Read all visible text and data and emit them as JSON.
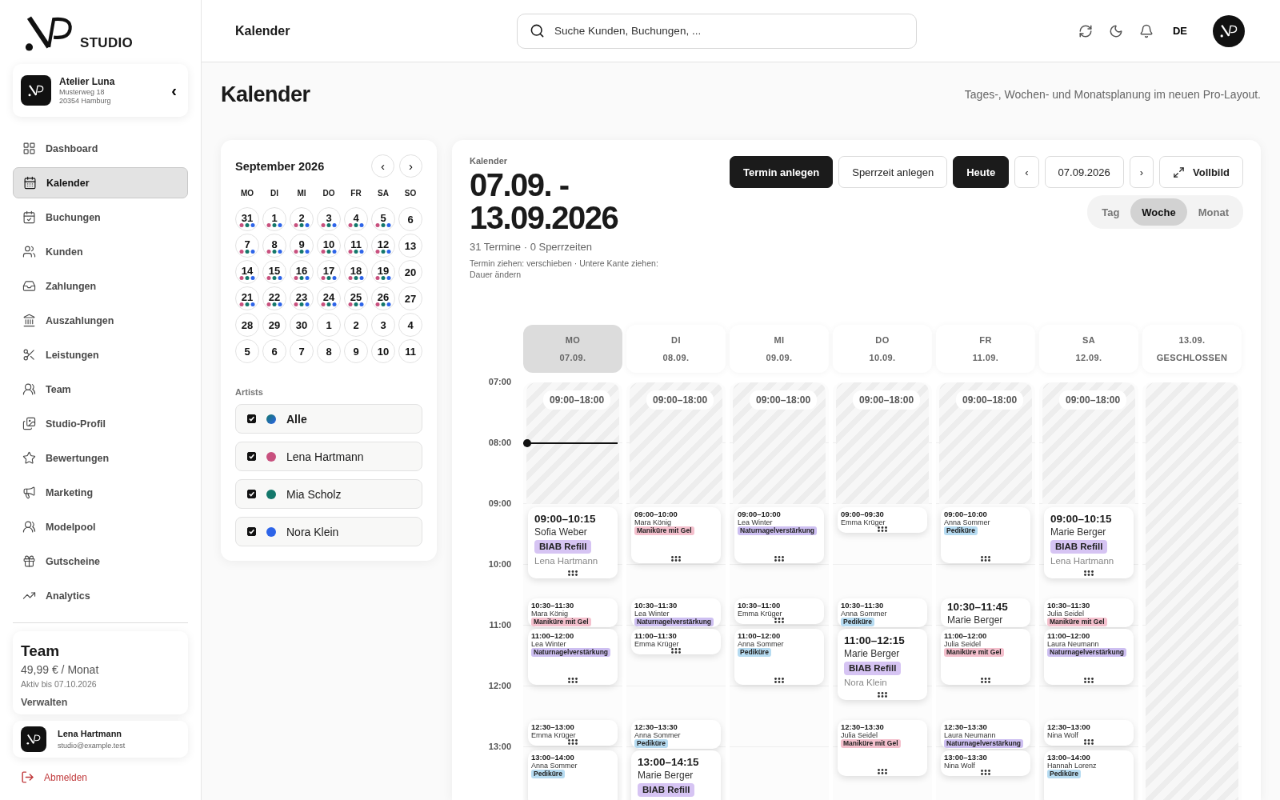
{
  "sidebar": {
    "brand": "STUDIO",
    "studio": {
      "name": "Atelier Luna",
      "street": "Musterweg 18",
      "city": "20354 Hamburg",
      "collapse": "‹"
    },
    "nav": [
      {
        "label": "Dashboard",
        "selected": false
      },
      {
        "label": "Kalender",
        "selected": true
      },
      {
        "label": "Buchungen",
        "selected": false
      },
      {
        "label": "Kunden",
        "selected": false
      },
      {
        "label": "Zahlungen",
        "selected": false
      },
      {
        "label": "Auszahlungen",
        "selected": false
      },
      {
        "label": "Leistungen",
        "selected": false
      },
      {
        "label": "Team",
        "selected": false
      },
      {
        "label": "Studio-Profil",
        "selected": false
      },
      {
        "label": "Bewertungen",
        "selected": false
      },
      {
        "label": "Marketing",
        "selected": false
      },
      {
        "label": "Modelpool",
        "selected": false
      },
      {
        "label": "Gutscheine",
        "selected": false
      },
      {
        "label": "Analytics",
        "selected": false
      }
    ],
    "plan": {
      "name": "Team",
      "price": "49,99 € / Monat",
      "valid": "Aktiv bis 07.10.2026",
      "action": "Verwalten"
    },
    "user": {
      "name": "Lena Hartmann",
      "email": "studio@example.test"
    },
    "logout": "Abmelden"
  },
  "topbar": {
    "title": "Kalender",
    "search": {
      "placeholder": "Suche Kunden, Buchungen, ..."
    },
    "language": "DE"
  },
  "page": {
    "title": "Kalender",
    "subtitle": "Tages-, Wochen- und Monatsplanung im neuen Pro-Layout."
  },
  "mini_calendar": {
    "month": "September 2026",
    "prev": "‹",
    "next": "›",
    "weekdays": [
      "MO",
      "DI",
      "MI",
      "DO",
      "FR",
      "SA",
      "SO"
    ],
    "weeks": [
      [
        {
          "label": "31",
          "booked": true
        },
        {
          "label": "1",
          "booked": true
        },
        {
          "label": "2",
          "booked": true
        },
        {
          "label": "3",
          "booked": true
        },
        {
          "label": "4",
          "booked": true
        },
        {
          "label": "5",
          "booked": true
        },
        {
          "label": "6",
          "booked": false
        }
      ],
      [
        {
          "label": "7",
          "booked": true
        },
        {
          "label": "8",
          "booked": true
        },
        {
          "label": "9",
          "booked": true
        },
        {
          "label": "10",
          "booked": true
        },
        {
          "label": "11",
          "booked": true
        },
        {
          "label": "12",
          "booked": true
        },
        {
          "label": "13",
          "booked": false
        }
      ],
      [
        {
          "label": "14",
          "booked": true
        },
        {
          "label": "15",
          "booked": true
        },
        {
          "label": "16",
          "booked": true
        },
        {
          "label": "17",
          "booked": true
        },
        {
          "label": "18",
          "booked": true
        },
        {
          "label": "19",
          "booked": true
        },
        {
          "label": "20",
          "booked": false
        }
      ],
      [
        {
          "label": "21",
          "booked": true
        },
        {
          "label": "22",
          "booked": true
        },
        {
          "label": "23",
          "booked": true
        },
        {
          "label": "24",
          "booked": true
        },
        {
          "label": "25",
          "booked": true
        },
        {
          "label": "26",
          "booked": true
        },
        {
          "label": "27",
          "booked": false
        }
      ],
      [
        {
          "label": "28",
          "booked": false
        },
        {
          "label": "29",
          "booked": false
        },
        {
          "label": "30",
          "booked": false
        },
        {
          "label": "1",
          "booked": false
        },
        {
          "label": "2",
          "booked": false
        },
        {
          "label": "3",
          "booked": false
        },
        {
          "label": "4",
          "booked": false
        }
      ],
      [
        {
          "label": "5",
          "booked": false
        },
        {
          "label": "6",
          "booked": false
        },
        {
          "label": "7",
          "booked": false
        },
        {
          "label": "8",
          "booked": false
        },
        {
          "label": "9",
          "booked": false
        },
        {
          "label": "10",
          "booked": false
        },
        {
          "label": "11",
          "booked": false
        }
      ]
    ],
    "artists_label": "Artists",
    "artists": [
      {
        "kind": "all",
        "name": "Alle",
        "checked": true
      },
      {
        "kind": "artist",
        "name": "Lena Hartmann",
        "checked": true,
        "color": "#c8507e"
      },
      {
        "kind": "artist",
        "name": "Mia Scholz",
        "checked": true,
        "color": "#13776a"
      },
      {
        "kind": "artist",
        "name": "Nora Klein",
        "checked": true,
        "color": "#2d64e8"
      }
    ]
  },
  "calendar": {
    "label": "Kalender",
    "range": "07.09. - 13.09.2026",
    "summary": "31 Termine · 0 Sperrzeiten",
    "hint": "Termin ziehen: verschieben · Untere Kante ziehen: Dauer ändern",
    "actions": [
      {
        "label": "Termin anlegen",
        "kind": "primary"
      },
      {
        "label": "Sperrzeit anlegen",
        "kind": "secondary"
      },
      {
        "label": "Heute",
        "kind": "primary"
      },
      {
        "label": "‹",
        "kind": "secondary"
      },
      {
        "label": "07.09.2026",
        "kind": "secondary"
      },
      {
        "label": "›",
        "kind": "secondary"
      },
      {
        "label": "Vollbild",
        "kind": "fullscreen"
      }
    ],
    "views": [
      {
        "label": "Tag",
        "selected": false
      },
      {
        "label": "Woche",
        "selected": true
      },
      {
        "label": "Monat",
        "selected": false
      }
    ],
    "times": [
      "07:00",
      "08:00",
      "09:00",
      "10:00",
      "11:00",
      "12:00",
      "13:00"
    ],
    "days": [
      {
        "weekday": "MO",
        "date": "07.09.",
        "selected": true,
        "closed": false,
        "now_marker": true,
        "hours": "09:00–18:00",
        "appointments": [
          {
            "kind": "detail",
            "time": "09:00–10:15",
            "client": "Sofia Weber",
            "service": {
              "label": "BIAB Refill",
              "color": "#d6c4f3"
            },
            "artist": "Lena Hartmann"
          },
          {
            "kind": "compact",
            "time": "10:30–11:30",
            "client": "Mara König",
            "service": {
              "label": "Maniküre mit Gel",
              "color": "#f4c0cd"
            }
          },
          {
            "kind": "compact",
            "time": "11:00–12:00",
            "client": "Lea Winter",
            "service": {
              "label": "Naturnagelverstärkung",
              "color": "#cdbff1"
            }
          },
          {
            "kind": "compact",
            "time": "12:30–13:00",
            "client": "Emma Krüger"
          },
          {
            "kind": "compact",
            "time": "13:00–14:00",
            "client": "Anna Sommer",
            "service": {
              "label": "Pediküre",
              "color": "#b6dbf1"
            }
          }
        ]
      },
      {
        "weekday": "DI",
        "date": "08.09.",
        "selected": false,
        "closed": false,
        "now_marker": false,
        "hours": "09:00–18:00",
        "appointments": [
          {
            "kind": "compact",
            "time": "09:00–10:00",
            "client": "Mara König",
            "service": {
              "label": "Maniküre mit Gel",
              "color": "#f4c0cd"
            }
          },
          {
            "kind": "compact",
            "time": "10:30–11:30",
            "client": "Lea Winter",
            "service": {
              "label": "Naturnagelverstärkung",
              "color": "#cdbff1"
            }
          },
          {
            "kind": "compact",
            "time": "11:00–11:30",
            "client": "Emma Krüger"
          },
          {
            "kind": "compact",
            "time": "12:30–13:30",
            "client": "Anna Sommer",
            "service": {
              "label": "Pediküre",
              "color": "#b6dbf1"
            }
          },
          {
            "kind": "detail",
            "time": "13:00–14:15",
            "client": "Marie Berger",
            "service": {
              "label": "BIAB Refill",
              "color": "#d6c4f3"
            }
          }
        ]
      },
      {
        "weekday": "MI",
        "date": "09.09.",
        "selected": false,
        "closed": false,
        "now_marker": false,
        "hours": "09:00–18:00",
        "appointments": [
          {
            "kind": "compact",
            "time": "09:00–10:00",
            "client": "Lea Winter",
            "service": {
              "label": "Naturnagelverstärkung",
              "color": "#cdbff1"
            }
          },
          {
            "kind": "compact",
            "time": "10:30–11:00",
            "client": "Emma Krüger"
          },
          {
            "kind": "compact",
            "time": "11:00–12:00",
            "client": "Anna Sommer",
            "service": {
              "label": "Pediküre",
              "color": "#b6dbf1"
            }
          }
        ]
      },
      {
        "weekday": "DO",
        "date": "10.09.",
        "selected": false,
        "closed": false,
        "now_marker": false,
        "hours": "09:00–18:00",
        "appointments": [
          {
            "kind": "compact",
            "time": "09:00–09:30",
            "client": "Emma Krüger"
          },
          {
            "kind": "compact",
            "time": "10:30–11:30",
            "client": "Anna Sommer",
            "service": {
              "label": "Pediküre",
              "color": "#b6dbf1"
            }
          },
          {
            "kind": "detail",
            "time": "11:00–12:15",
            "client": "Marie Berger",
            "service": {
              "label": "BIAB Refill",
              "color": "#d6c4f3"
            },
            "artist": "Nora Klein"
          },
          {
            "kind": "compact",
            "time": "12:30–13:30",
            "client": "Julia Seidel",
            "service": {
              "label": "Maniküre mit Gel",
              "color": "#f4c0cd"
            }
          }
        ]
      },
      {
        "weekday": "FR",
        "date": "11.09.",
        "selected": false,
        "closed": false,
        "now_marker": false,
        "hours": "09:00–18:00",
        "appointments": [
          {
            "kind": "compact",
            "time": "09:00–10:00",
            "client": "Anna Sommer",
            "service": {
              "label": "Pediküre",
              "color": "#b6dbf1"
            }
          },
          {
            "kind": "detail",
            "time": "10:30–11:45",
            "client": "Marie Berger"
          },
          {
            "kind": "compact",
            "time": "11:00–12:00",
            "client": "Julia Seidel",
            "service": {
              "label": "Maniküre mit Gel",
              "color": "#f4c0cd"
            }
          },
          {
            "kind": "compact",
            "time": "12:30–13:30",
            "client": "Laura Neumann",
            "service": {
              "label": "Naturnagelverstärkung",
              "color": "#cdbff1"
            }
          },
          {
            "kind": "compact",
            "time": "13:00–13:30",
            "client": "Nina Wolf"
          }
        ]
      },
      {
        "weekday": "SA",
        "date": "12.09.",
        "selected": false,
        "closed": false,
        "now_marker": false,
        "hours": "09:00–18:00",
        "appointments": [
          {
            "kind": "detail",
            "time": "09:00–10:15",
            "client": "Marie Berger",
            "service": {
              "label": "BIAB Refill",
              "color": "#d6c4f3"
            },
            "artist": "Lena Hartmann"
          },
          {
            "kind": "compact",
            "time": "10:30–11:30",
            "client": "Julia Seidel",
            "service": {
              "label": "Maniküre mit Gel",
              "color": "#f4c0cd"
            }
          },
          {
            "kind": "compact",
            "time": "11:00–12:00",
            "client": "Laura Neumann",
            "service": {
              "label": "Naturnagelverstärkung",
              "color": "#cdbff1"
            }
          },
          {
            "kind": "compact",
            "time": "12:30–13:00",
            "client": "Nina Wolf"
          },
          {
            "kind": "compact",
            "time": "13:00–14:00",
            "client": "Hannah Lorenz",
            "service": {
              "label": "Pediküre",
              "color": "#b6dbf1"
            }
          }
        ]
      },
      {
        "date": "13.09.",
        "status": "GESCHLOSSEN",
        "selected": false,
        "closed": true,
        "now_marker": false
      }
    ]
  }
}
